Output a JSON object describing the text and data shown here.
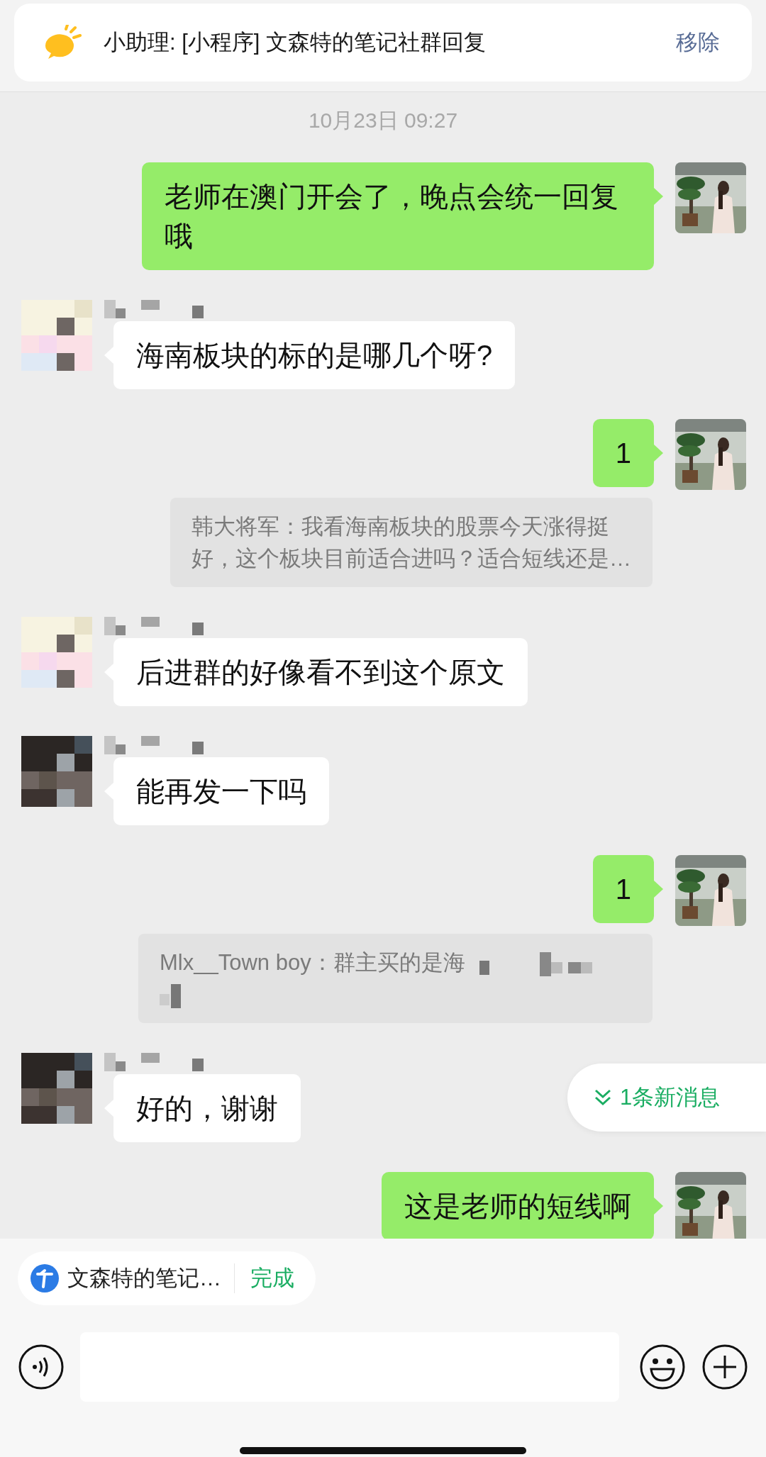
{
  "banner": {
    "text": "小助理: [小程序] 文森特的笔记社群回复",
    "action": "移除"
  },
  "timestamp": "10月23日 09:27",
  "messages": [
    {
      "kind": "sent",
      "text": "老师在澳门开会了，晚点会统一回复哦"
    },
    {
      "kind": "received",
      "text": "海南板块的标的是哪几个呀?"
    },
    {
      "kind": "sent",
      "text": "1"
    },
    {
      "kind": "quote",
      "text": "韩大将军：我看海南板块的股票今天涨得挺好，这个板块目前适合进吗？适合短线还是…",
      "redacted": false
    },
    {
      "kind": "received",
      "text": "后进群的好像看不到这个原文"
    },
    {
      "kind": "received",
      "text": "能再发一下吗"
    },
    {
      "kind": "sent",
      "text": "1"
    },
    {
      "kind": "quote",
      "text": "Mlx__Town boy：群主买的是海",
      "redacted": true
    },
    {
      "kind": "received",
      "text": "好的，谢谢"
    },
    {
      "kind": "sent",
      "text": "这是老师的短线啊"
    }
  ],
  "new_messages": {
    "text": "1条新消息"
  },
  "mini_program": {
    "title": "文森特的笔记…",
    "action": "完成"
  }
}
